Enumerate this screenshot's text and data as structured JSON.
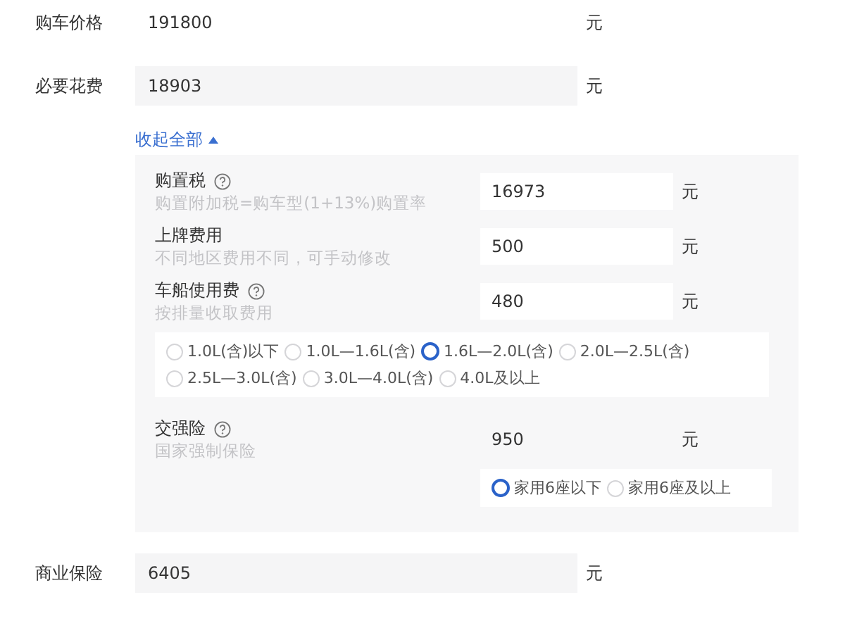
{
  "fields_top": [
    {
      "label": "购车价格",
      "value": "191800",
      "unit": "元",
      "kind": "input"
    },
    {
      "label": "必要花费",
      "value": "18903",
      "unit": "元",
      "kind": "readout"
    }
  ],
  "collapse": {
    "label": "收起全部",
    "expanded": true
  },
  "details": [
    {
      "label": "购置税",
      "help": true,
      "hint": "购置附加税=购车型(1+13%)购置率",
      "value": "16973",
      "unit": "元",
      "boxed": true
    },
    {
      "label": "上牌费用",
      "help": false,
      "hint": "不同地区费用不同，可手动修改",
      "value": "500",
      "unit": "元",
      "boxed": true
    },
    {
      "label": "车船使用费",
      "help": true,
      "hint": "按排量收取费用",
      "value": "480",
      "unit": "元",
      "boxed": true,
      "kind": "wide_options",
      "options": [
        {
          "label": "1.0L(含)以下",
          "selected": false
        },
        {
          "label": "1.0L—1.6L(含)",
          "selected": false
        },
        {
          "label": "1.6L—2.0L(含)",
          "selected": true
        },
        {
          "label": "2.0L—2.5L(含)",
          "selected": false
        },
        {
          "label": "2.5L—3.0L(含)",
          "selected": false
        },
        {
          "label": "3.0L—4.0L(含)",
          "selected": false
        },
        {
          "label": "4.0L及以上",
          "selected": false
        }
      ]
    },
    {
      "label": "交强险",
      "help": true,
      "hint": "国家强制保险",
      "value": "950",
      "unit": "元",
      "boxed": false,
      "kind": "side_options",
      "options": [
        {
          "label": "家用6座以下",
          "selected": true
        },
        {
          "label": "家用6座及以上",
          "selected": false
        }
      ]
    }
  ],
  "fields_bottom": [
    {
      "label": "商业保险",
      "value": "6405",
      "unit": "元",
      "kind": "readout"
    }
  ]
}
